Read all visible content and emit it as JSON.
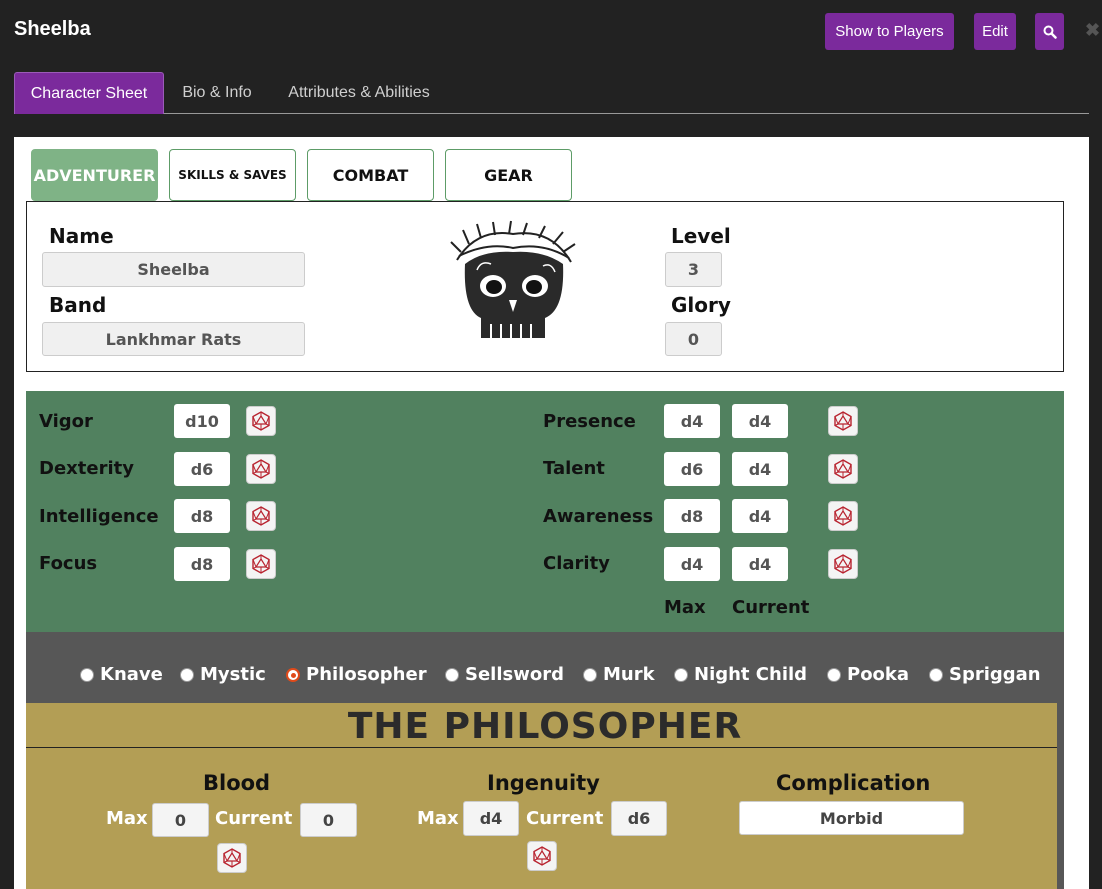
{
  "window": {
    "title": "Sheelba",
    "show_to_players": "Show to Players",
    "edit": "Edit",
    "search_icon": "search-icon",
    "close_icon": "close-icon"
  },
  "tabs": [
    "Character Sheet",
    "Bio & Info",
    "Attributes & Abilities"
  ],
  "sheet_tabs": [
    "ADVENTURER",
    "SKILLS & SAVES",
    "COMBAT",
    "GEAR"
  ],
  "header": {
    "name_label": "Name",
    "name_value": "Sheelba",
    "band_label": "Band",
    "band_value": "Lankhmar Rats",
    "level_label": "Level",
    "level_value": "3",
    "glory_label": "Glory",
    "glory_value": "0",
    "portrait": "skull-with-thorn-crown"
  },
  "attributes_left": [
    {
      "label": "Vigor",
      "die": "d10"
    },
    {
      "label": "Dexterity",
      "die": "d6"
    },
    {
      "label": "Intelligence",
      "die": "d8"
    },
    {
      "label": "Focus",
      "die": "d8"
    }
  ],
  "attributes_right": [
    {
      "label": "Presence",
      "max": "d4",
      "current": "d4"
    },
    {
      "label": "Talent",
      "max": "d6",
      "current": "d4"
    },
    {
      "label": "Awareness",
      "max": "d8",
      "current": "d4"
    },
    {
      "label": "Clarity",
      "max": "d4",
      "current": "d4"
    }
  ],
  "col_max": "Max",
  "col_current": "Current",
  "archetypes": [
    "Knave",
    "Mystic",
    "Philosopher",
    "Sellsword",
    "Murk",
    "Night Child",
    "Pooka",
    "Spriggan"
  ],
  "selected_archetype": "Philosopher",
  "philosopher": {
    "title": "THE PHILOSOPHER",
    "blood_label": "Blood",
    "blood_max": "0",
    "blood_current": "0",
    "ingenuity_label": "Ingenuity",
    "ingenuity_max": "d4",
    "ingenuity_current": "d6",
    "complication_label": "Complication",
    "complication_value": "Morbid",
    "max_label": "Max",
    "current_label": "Current"
  },
  "colors": {
    "accent": "#7b2a9c",
    "green_panel": "#51815f",
    "tan_panel": "#b39e55",
    "gray_panel": "#575757",
    "dice_red": "#b8232f"
  }
}
